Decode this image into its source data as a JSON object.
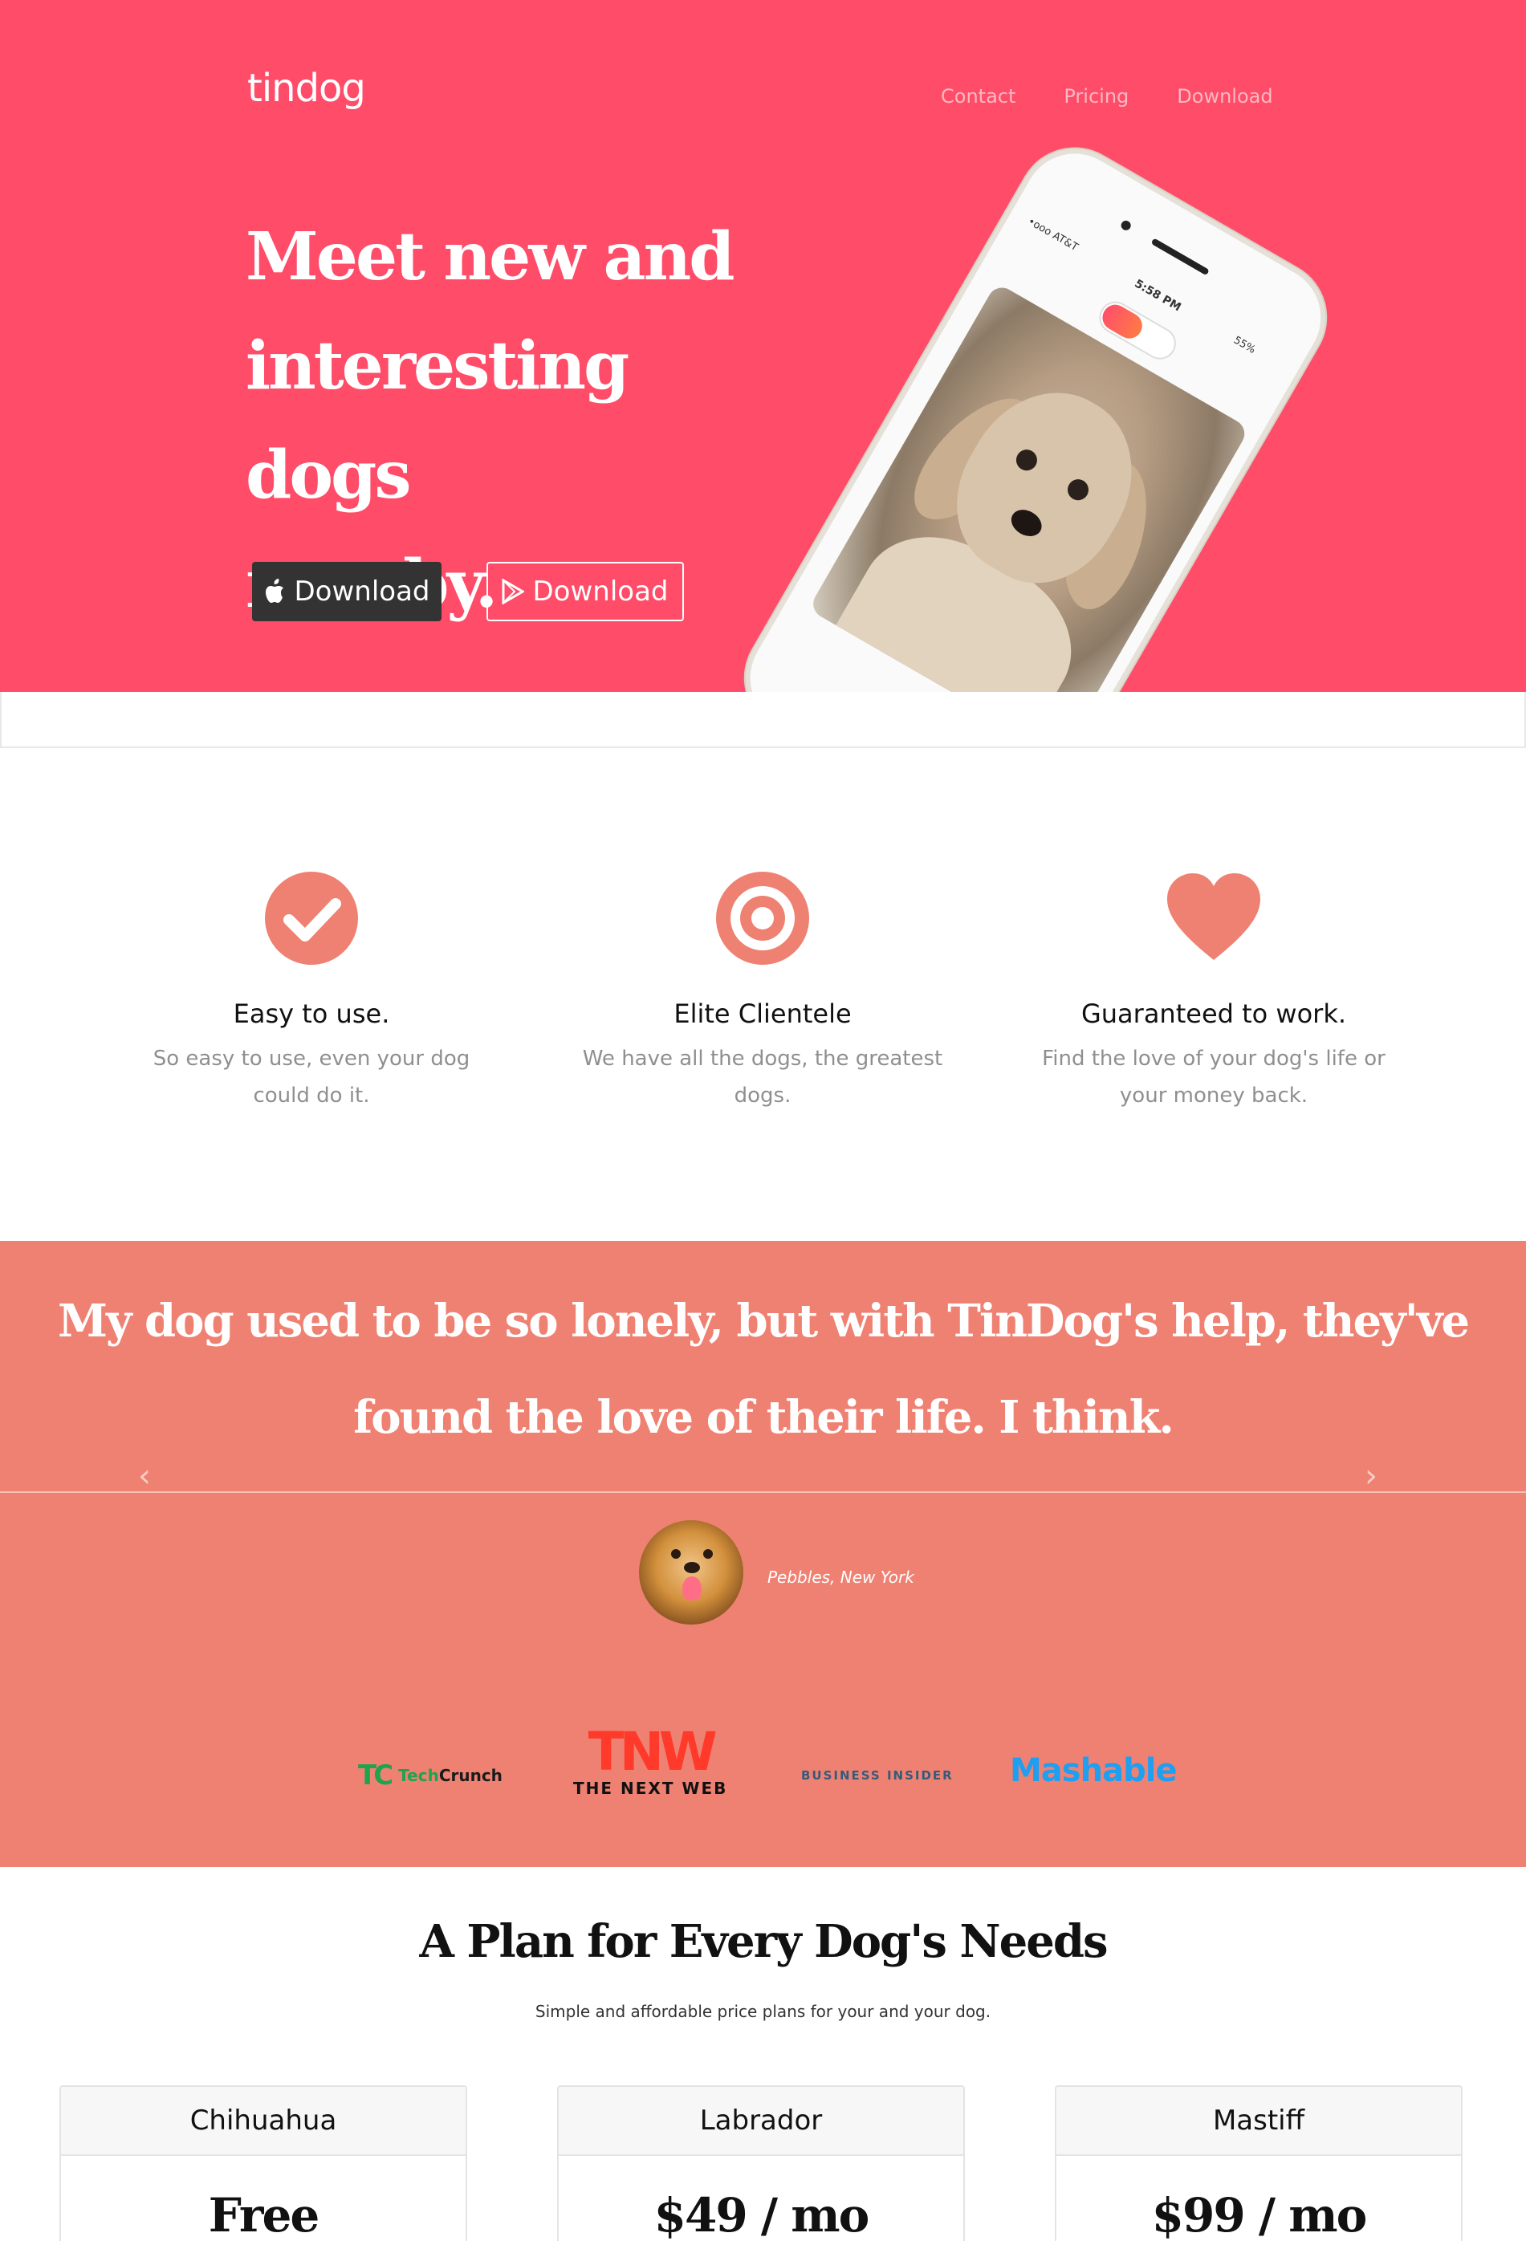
{
  "nav": {
    "brand": "tindog",
    "links": [
      "Contact",
      "Pricing",
      "Download"
    ]
  },
  "hero": {
    "title_lines": [
      "Meet new and",
      "interesting dogs",
      "nearby."
    ],
    "buttons": {
      "apple_label": "Download",
      "play_label": "Download"
    },
    "phone": {
      "carrier": "•ooo AT&T",
      "time": "5:58 PM",
      "battery": "55%"
    }
  },
  "features": [
    {
      "icon": "check-circle-icon",
      "title": "Easy to use.",
      "desc": "So easy to use, even your dog could do it."
    },
    {
      "icon": "bullseye-icon",
      "title": "Elite Clientele",
      "desc": "We have all the dogs, the greatest dogs."
    },
    {
      "icon": "heart-icon",
      "title": "Guaranteed to work.",
      "desc": "Find the love of your dog's life or your money back."
    }
  ],
  "testimonial": {
    "quote": "My dog used to be so lonely, but with TinDog's help, they've found the love of their life. I think.",
    "author": "Pebbles, New York",
    "prev": "‹",
    "next": "›"
  },
  "press": {
    "techcrunch_mark": "TC",
    "techcrunch_text_a": "Tech",
    "techcrunch_text_b": "Crunch",
    "tnw_mark": "TNW",
    "tnw_text": "THE NEXT WEB",
    "business_insider": "BUSINESS INSIDER",
    "mashable": "Mashable"
  },
  "pricing": {
    "title": "A Plan for Every Dog's Needs",
    "subtitle": "Simple and affordable price plans for your and your dog.",
    "plans": [
      {
        "name": "Chihuahua",
        "price": "Free"
      },
      {
        "name": "Labrador",
        "price": "$49 / mo"
      },
      {
        "name": "Mastiff",
        "price": "$99 / mo"
      }
    ]
  },
  "colors": {
    "hero_bg": "#ff4c68",
    "accent": "#ef8172",
    "dark_button": "#333333"
  }
}
